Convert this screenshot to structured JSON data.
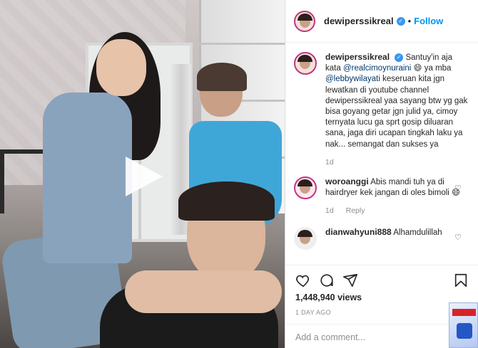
{
  "post": {
    "username": "dewiperssikreal",
    "follow_label": "Follow",
    "dot": "•",
    "verified_mark": "✓",
    "caption": {
      "author": "dewiperssikreal",
      "part1": "Santuy'in aja kata ",
      "mention1": "@realcimoynuraini",
      "part2": " 😄 ya mba ",
      "mention2": "@lebbywilayati",
      "part3": " keseruan kita jgn lewatkan di youtube channel dewiperssikreal yaa sayang btw yg gak bisa goyang getar jgn julid ya, cimoy ternyata lucu ga sprt gosip diluaran sana, jaga diri ucapan tingkah laku ya nak... semangat dan sukses ya",
      "time": "1d"
    },
    "comments": [
      {
        "author": "woroanggi",
        "text": "Abis mandi tuh ya di hairdryer kek jangan di oles bimoli 😄",
        "time": "1d",
        "reply_label": "Reply"
      },
      {
        "author": "dianwahyuni888",
        "text": "Alhamdulillah"
      }
    ],
    "views": "1,448,940 views",
    "date": "1 DAY AGO",
    "add_comment_placeholder": "Add a comment..."
  },
  "icons": {
    "like": "heart-icon",
    "comment": "comment-icon",
    "share": "share-icon",
    "save": "bookmark-icon",
    "play": "play-icon"
  },
  "colors": {
    "accent": "#0095f6",
    "mention": "#00376b",
    "muted": "#8e8e8e",
    "story_ring": "#c13584"
  }
}
